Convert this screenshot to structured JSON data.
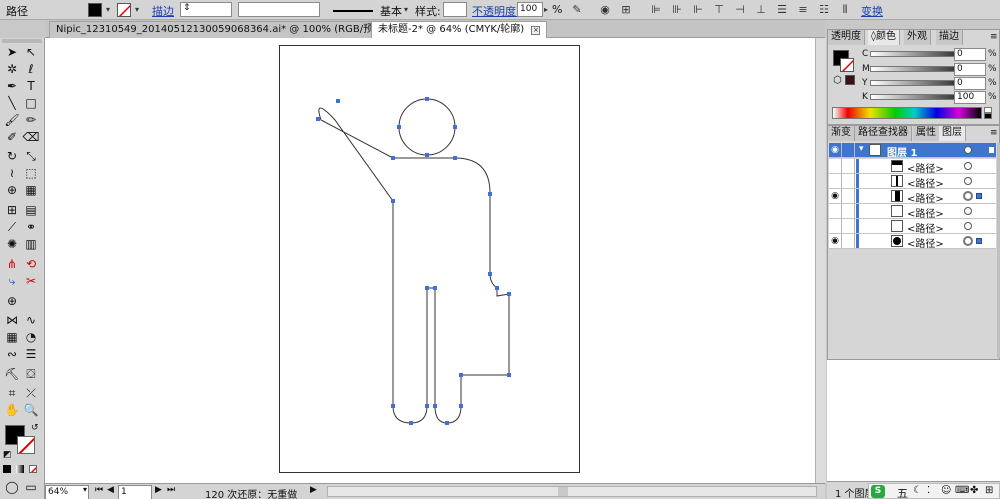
{
  "control_bar": {
    "object_type": "路径",
    "stroke_label": "描边",
    "stroke_weight": "",
    "brush_label": "基本",
    "style_label": "样式:",
    "opacity_label": "不透明度:",
    "opacity_value": "100",
    "opacity_unit": "%",
    "transform_label": "变换"
  },
  "tabs": [
    {
      "label": "Nipic_12310549_20140512130059068364.ai* @ 100% (RGB/预览)"
    },
    {
      "label": "未标题-2* @ 64% (CMYK/轮廓)"
    }
  ],
  "status_bar": {
    "zoom": "64%",
    "page": "1",
    "history": "120 次还原：无重做"
  },
  "color_panel": {
    "tabs": [
      "透明度",
      "颜色",
      "外观",
      "描边"
    ],
    "active_tab": "颜色",
    "channels": [
      {
        "label": "C",
        "value": "0"
      },
      {
        "label": "M",
        "value": "0"
      },
      {
        "label": "Y",
        "value": "0"
      },
      {
        "label": "K",
        "value": "100"
      }
    ],
    "pct": "%"
  },
  "layers_panel": {
    "tabs": [
      "渐变",
      "路径查找器",
      "属性",
      "图层"
    ],
    "active_tab": "图层",
    "layer_name": "图层 1",
    "rows": [
      {
        "label": "<路径>"
      },
      {
        "label": "<路径>"
      },
      {
        "label": "<路径>"
      },
      {
        "label": "<路径>"
      },
      {
        "label": "<路径>"
      },
      {
        "label": "<路径>"
      }
    ],
    "footer_count": "1 个图层"
  },
  "ime": {
    "label": "五"
  },
  "colors": {
    "accent": "#3f75cf",
    "canvas": "#ffffff",
    "ui_gray": "#d4d4d4",
    "anchor": "#3f6fd8"
  }
}
